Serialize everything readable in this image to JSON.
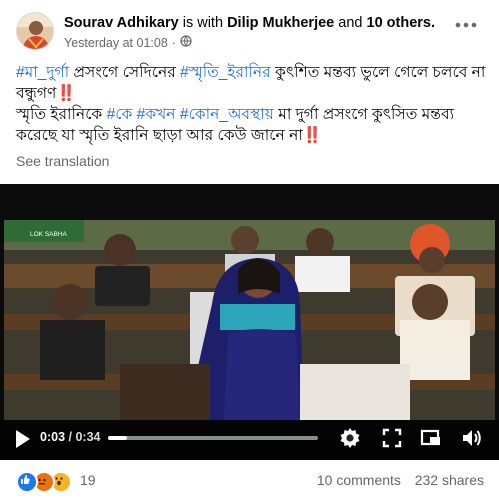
{
  "post": {
    "author": "Sourav Adhikary",
    "with_text": "is with",
    "tagged": "Dilip Mukherjee",
    "and_text": "and",
    "others": "10 others.",
    "timestamp": "Yesterday at 01:08",
    "privacy_icon": "globe-icon",
    "more_icon": "more-horizontal-icon",
    "text": {
      "l1_tag1": "#মা_দুর্গা",
      "l1_t1": " প্রসংগে সেদিনের ",
      "l1_tag2": "#স্মৃতি_ইরানির",
      "l1_t2": " কুৎশিত মন্তব্য ভুলে গেলে চলবে না বন্ধুগণ",
      "bang": "‼️",
      "l2_t0": "স্মৃতি ইরানিকে ",
      "l2_tag1": "#কে",
      "l2_tag2": "#কখন",
      "l2_tag3": "#কোন_অবস্থায়",
      "l2_t1": " মা দুর্গা প্রসংগে কুৎসিত মন্তব্য করেছে যা স্মৃতি ইরানি ছাড়া আর কেউ জানে না"
    },
    "see_translation": "See translation"
  },
  "video": {
    "sign_text": "LOK SABHA",
    "current_time": "0:03",
    "separator": " / ",
    "duration": "0:34",
    "progress": 0.09,
    "play_icon": "play-icon",
    "settings_icon": "settings-gear-icon",
    "fullscreen_icon": "fullscreen-icon",
    "pip_icon": "picture-in-picture-icon",
    "volume_icon": "volume-icon"
  },
  "engagement": {
    "reaction_icons": [
      "like-icon",
      "angry-icon",
      "wow-icon"
    ],
    "reaction_count": "19",
    "comments": "10 comments",
    "shares": "232 shares"
  },
  "colors": {
    "hashtag": "#216fdb",
    "secondary_text": "#65676b",
    "like": "#1877f2",
    "angry": "#e9710f",
    "wow": "#f7b125"
  }
}
